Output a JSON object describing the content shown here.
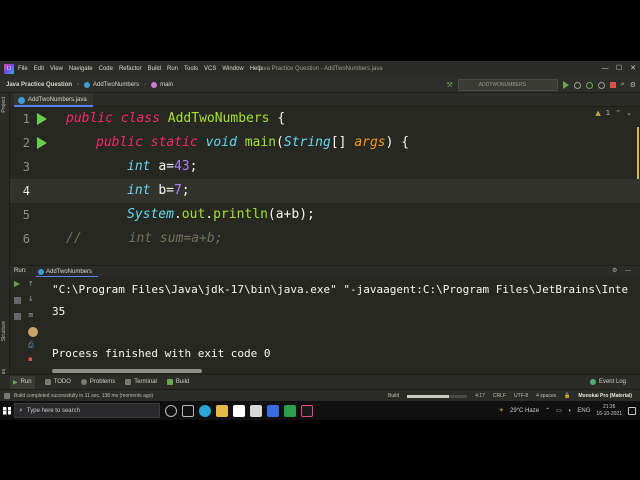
{
  "menubar": {
    "logo": "IJ",
    "items": [
      "File",
      "Edit",
      "View",
      "Navigate",
      "Code",
      "Refactor",
      "Build",
      "Run",
      "Tools",
      "VCS",
      "Window",
      "Help"
    ],
    "window_title": "Java Practice Question - AddTwoNumbers.java"
  },
  "navbar": {
    "project": "Java Practice Question",
    "file": "AddTwoNumbers",
    "method": "main",
    "run_config": "ADDTWONUMBERS"
  },
  "tool_windows": {
    "project": "Project",
    "structure": "Structure",
    "favorites": "Favorites"
  },
  "editor": {
    "tab": "AddTwoNumbers.java",
    "line_numbers": [
      "1",
      "2",
      "3",
      "4",
      "5",
      "6"
    ],
    "lines": {
      "l1": {
        "kw1": "public",
        "kw2": "class",
        "name": "AddTwoNumbers",
        "brace": "{"
      },
      "l2": {
        "kw1": "public",
        "kw2": "static",
        "kw3": "void",
        "fn": "main",
        "open": "(",
        "type": "String",
        "arr": "[] ",
        "param": "args",
        "close": ") {"
      },
      "l3": {
        "type": "int",
        "var": "a=",
        "num": "43",
        "end": ";"
      },
      "l4": {
        "type": "int",
        "var": "b=",
        "num": "7",
        "end": ";"
      },
      "l5": {
        "cls": "System",
        "dot1": ".",
        "field": "out",
        "dot2": ".",
        "method": "println",
        "args": "(a+b);"
      },
      "l6": {
        "comment": "//      int sum=a+b;"
      }
    },
    "inspection": "1"
  },
  "run": {
    "label": "Run:",
    "tab": "AddTwoNumbers",
    "output": [
      "\"C:\\Program Files\\Java\\jdk-17\\bin\\java.exe\" \"-javaagent:C:\\Program Files\\JetBrains\\Inte",
      "35",
      "",
      "Process finished with exit code 0"
    ]
  },
  "bottom_tools": {
    "run": "Run",
    "todo": "TODO",
    "problems": "Problems",
    "terminal": "Terminal",
    "build": "Build",
    "event_log": "Event Log"
  },
  "statusbar": {
    "message": "Build completed successfully in 11 sec, 138 ms (moments ago)",
    "build": "Build",
    "position": "4:17",
    "line_sep": "CRLF",
    "encoding": "UTF-8",
    "indent": "4 spaces",
    "theme": "Monokai Pro (Material)"
  },
  "taskbar": {
    "search_placeholder": "Type here to search",
    "weather": "29°C  Haze",
    "lang": "ENG",
    "time": "21:26",
    "date": "16-10-2021"
  }
}
